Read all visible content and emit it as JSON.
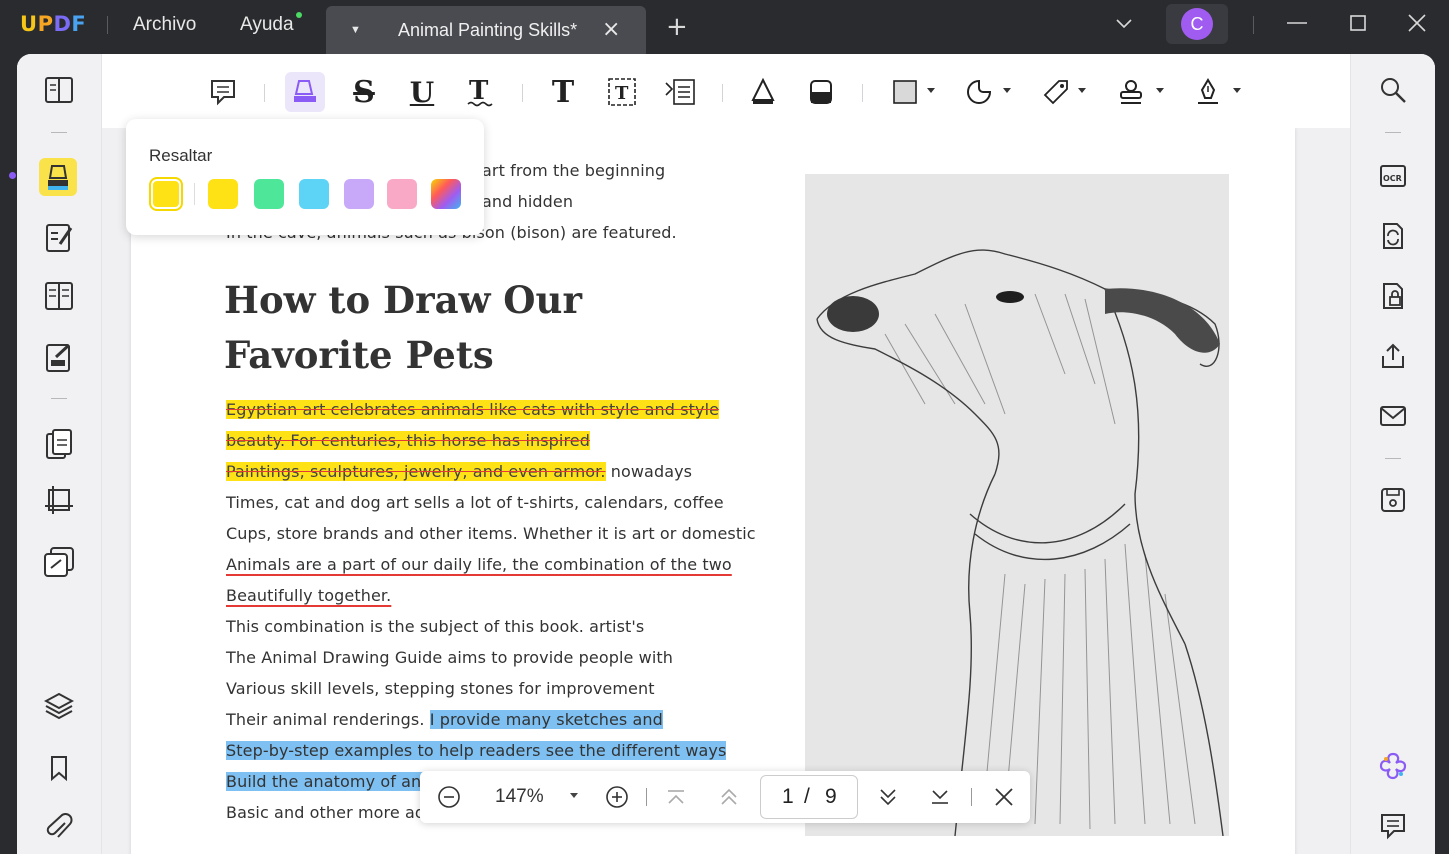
{
  "app": {
    "logo": "UPDF"
  },
  "menu": {
    "file": "Archivo",
    "help": "Ayuda"
  },
  "tab": {
    "title": "Animal Painting Skills*"
  },
  "user": {
    "avatar_letter": "C",
    "avatar_color": "#a05cf0"
  },
  "highlight_popup": {
    "label": "Resaltar",
    "colors": [
      "#ffe216",
      "#4ee79a",
      "#5dd3f5",
      "#c8a8f8",
      "#f9a9c6",
      "rainbow"
    ],
    "selected_color": "#ffe216"
  },
  "document": {
    "intro_lines": [
      "art from the beginning",
      "and hidden",
      "In the cave, animals such as bison (bison) are featured."
    ],
    "heading_line1": "How to Draw Our",
    "heading_line2": "Favorite Pets",
    "strike_lines": [
      "Egyptian art celebrates animals like cats with style and style",
      "beauty. For centuries, this horse has inspired",
      "Paintings, sculptures, jewelry, and even armor."
    ],
    "strike_line3_tail": " nowadays",
    "body_lines_a": [
      "Times, cat and dog art sells a lot of t-shirts, calendars, coffee",
      "Cups, store brands and other items. Whether it is art or domestic"
    ],
    "underlined_lines": [
      "Animals are a part of our daily life, the combination of the two",
      "Beautifully together."
    ],
    "body_lines_b": [
      "This combination is the subject of this book. artist's",
      "The Animal Drawing Guide aims to provide people with",
      "Various skill levels, stepping stones for improvement"
    ],
    "mixed_line_prefix": "Their animal renderings. ",
    "blue_lines": [
      "I provide many sketches and",
      "Step-by-step examples to help readers see the different ways",
      "Build the anatomy of an ani"
    ],
    "last_line": "Basic and other more adva"
  },
  "page_nav": {
    "zoom": "147%",
    "current_page": "1",
    "separator": "/",
    "total_pages": "9"
  }
}
